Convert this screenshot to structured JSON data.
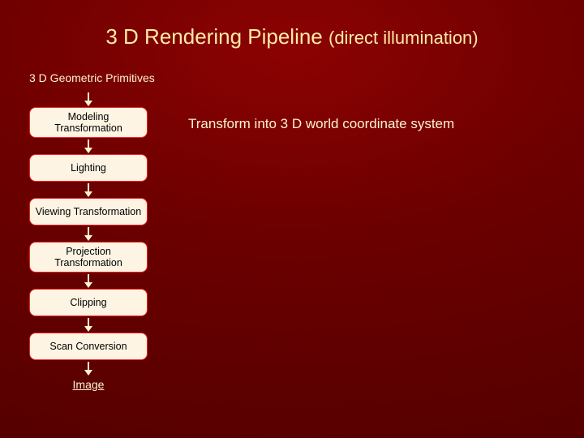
{
  "title": {
    "main": "3 D Rendering Pipeline",
    "sub": "(direct illumination)"
  },
  "top_label": "3 D Geometric Primitives",
  "stages": {
    "s0": "Modeling Transformation",
    "s1": "Lighting",
    "s2": "Viewing Transformation",
    "s3": "Projection Transformation",
    "s4": "Clipping",
    "s5": "Scan Conversion"
  },
  "bottom_label": "Image",
  "description": "Transform into 3 D world coordinate system"
}
